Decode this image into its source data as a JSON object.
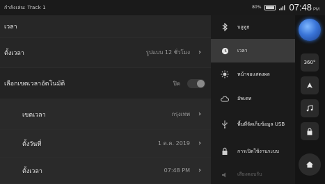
{
  "status": {
    "track": "กำลังเล่น: Track 1",
    "battery": "80%",
    "time": "07:48",
    "ampm": "PM"
  },
  "settings": {
    "section_title": "เวลา",
    "rows": [
      {
        "label": "ตั้งเวลา",
        "value": "รูปแบบ 12 ชั่วโมง"
      },
      {
        "label": "เลือกเขตเวลาอัตโนมัติ",
        "value": "ปิด"
      },
      {
        "label": "เขตเวลา",
        "value": "กรุงเทพ"
      },
      {
        "label": "ตั้งวันที่",
        "value": "1 ต.ค. 2019"
      },
      {
        "label": "ตั้งเวลา",
        "value": "07:48 PM"
      }
    ]
  },
  "menu": {
    "items": [
      {
        "label": "บลูทูธ",
        "icon": "bluetooth-icon"
      },
      {
        "label": "เวลา",
        "icon": "clock-icon",
        "active": true
      },
      {
        "label": "หน้าจอแสดงผล",
        "icon": "brightness-icon"
      },
      {
        "label": "อัพเดท",
        "icon": "update-icon"
      },
      {
        "label": "พื้นที่จัดเก็บข้อมูล USB",
        "icon": "usb-icon"
      },
      {
        "label": "การเปิดใช้งานระบบ",
        "icon": "lock-icon"
      },
      {
        "label": "เสียงตอบรับ",
        "icon": "speaker-icon",
        "dim": true
      }
    ]
  },
  "sidebar": {
    "view360": "360°"
  }
}
